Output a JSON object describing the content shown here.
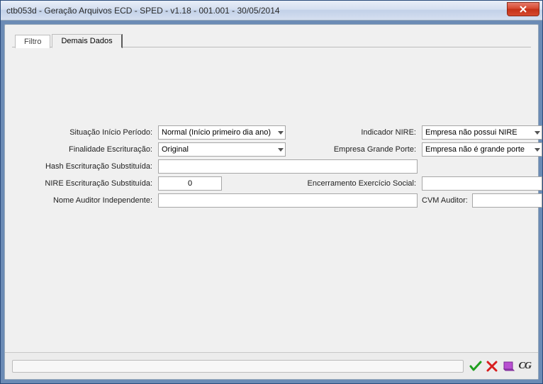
{
  "window": {
    "title": "ctb053d - Geração Arquivos ECD - SPED - v1.18 - 001.001 - 30/05/2014"
  },
  "tabs": {
    "filtro": "Filtro",
    "demais": "Demais Dados"
  },
  "labels": {
    "situacao": "Situação Início Período:",
    "finalidade": "Finalidade Escrituração:",
    "hash": "Hash Escrituração Substituída:",
    "nire_sub": "NIRE Escrituração Substituída:",
    "nome_auditor": "Nome Auditor Independente:",
    "indicador_nire": "Indicador NIRE:",
    "grande_porte": "Empresa Grande Porte:",
    "encerramento": "Encerramento Exercício Social:",
    "cvm_auditor": "CVM Auditor:"
  },
  "values": {
    "situacao": "Normal (Início primeiro dia ano)",
    "finalidade": "Original",
    "hash": "",
    "nire_sub": "0",
    "nome_auditor": "",
    "indicador_nire": "Empresa não possui NIRE",
    "grande_porte": "Empresa não é grande porte",
    "encerramento": "",
    "cvm_auditor": ""
  },
  "footer": {
    "cg": "CG"
  }
}
